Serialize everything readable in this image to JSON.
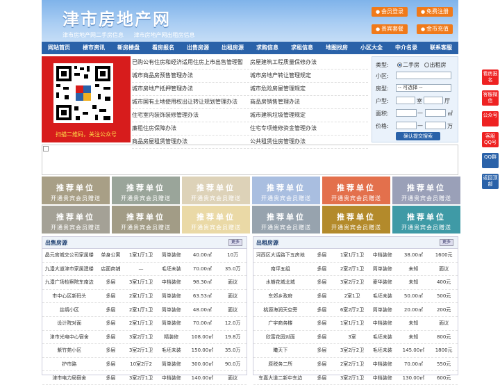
{
  "header": {
    "title": "津市房地产网",
    "tagline": [
      "津市房地产网二手房信息",
      "津市房地产网出租房信息"
    ],
    "buttons": [
      {
        "label": "会员登录",
        "icon": "user-icon"
      },
      {
        "label": "免费注册",
        "icon": "register-icon"
      },
      {
        "label": "贵宾套餐",
        "icon": "vip-icon"
      },
      {
        "label": "金币充值",
        "icon": "coin-icon"
      }
    ]
  },
  "nav": [
    "网站首页",
    "楼市资讯",
    "新房楼盘",
    "看房报名",
    "出售房源",
    "出租房源",
    "求购信息",
    "求租信息",
    "地图找房",
    "小区大全",
    "中介名录",
    "联系客服"
  ],
  "qr": {
    "caption": "扫描二维码，关注公众号"
  },
  "links": [
    [
      "已购公有住房和经济适用住房上市出售管理暂",
      "房屋建筑工程质量保修办法"
    ],
    [
      "城市商品房预售管理办法",
      "城市房地产转让管理规定"
    ],
    [
      "城市房地产抵押管理办法",
      "城市危险房屋管理规定"
    ],
    [
      "城市国有土地使用权出让转让规划管理办法",
      "商品房销售管理办法"
    ],
    [
      "住宅室内装饰装修管理办法",
      "城市建筑垃圾管理规定"
    ],
    [
      "廉租住房保障办法",
      "住宅专项维修资金管理办法"
    ],
    [
      "商品房屋租赁管理办法",
      "公共租赁住房管理办法"
    ]
  ],
  "search": {
    "type_label": "类型:",
    "type_options": [
      "二手房",
      "出租房"
    ],
    "district_label": "小区:",
    "house_label": "房型:",
    "house_value": "-- 可选择 --",
    "layout_label": "户型:",
    "room_unit": "室",
    "hall_unit": "厅",
    "area_label": "面积:",
    "area_unit": "㎡",
    "price_label": "价格:",
    "price_unit": "万",
    "range_sep": "—",
    "submit": "确认提交搜索"
  },
  "tiles": {
    "line1": "推荐单位",
    "line2": "开通贵宾会员赠送",
    "colors": [
      "#a89f86",
      "#9aa59a",
      "#ddd2b8",
      "#a9bee0",
      "#e3704c",
      "#9aa0b8",
      "#a4a196",
      "#a29c86",
      "#ead9a6",
      "#97a3ae",
      "#b38a2b",
      "#3f9aa6"
    ]
  },
  "sale": {
    "title": "出售房源",
    "more": "更多",
    "rows": [
      [
        "晶元宫城交公司家属楼",
        "单身公寓",
        "1室1厅1卫",
        "简单装修",
        "40.00㎡",
        "10万"
      ],
      [
        "九澧大道津市家属建楼",
        "店面商铺",
        "—",
        "毛坯未装",
        "70.00㎡",
        "35.0万"
      ],
      [
        "九澧广场检察院东南边",
        "多层",
        "3室1厅1卫",
        "中档装修",
        "98.30㎡",
        "面议"
      ],
      [
        "市中心区新码头",
        "多层",
        "2室1厅1卫",
        "简单装修",
        "63.53㎡",
        "面议"
      ],
      [
        "丝绸小区",
        "多层",
        "2室1厅1卫",
        "简单装修",
        "48.00㎡",
        "面议"
      ],
      [
        "设计院对面",
        "多层",
        "2室1厅1卫",
        "简单装修",
        "70.00㎡",
        "12.0万"
      ],
      [
        "津市光电中心宿舍",
        "多层",
        "3室2厅1卫",
        "精装修",
        "108.00㎡",
        "19.8万"
      ],
      [
        "紫竹苑小区",
        "多层",
        "3室2厅1卫",
        "毛坯未装",
        "150.00㎡",
        "35.0万"
      ],
      [
        "护市路",
        "多层",
        "10室2厅2",
        "简单装修",
        "300.00㎡",
        "90.0万"
      ],
      [
        "津市电力局宿舍",
        "多层",
        "3室2厅1卫",
        "中档装修",
        "140.00㎡",
        "面议"
      ]
    ]
  },
  "rent": {
    "title": "出租房源",
    "more": "更多",
    "rows": [
      [
        "河西区大话路下五房地",
        "多层",
        "1室1厅1卫",
        "中档装修",
        "38.00㎡",
        "1600元"
      ],
      [
        "南坪五组",
        "多层",
        "2室2厅1卫",
        "简单装修",
        "未知",
        "面议"
      ],
      [
        "水樹花城北城",
        "多层",
        "3室2厅2卫",
        "豪华装修",
        "未知",
        "400元"
      ],
      [
        "东郊乡政府",
        "多层",
        "2室1卫",
        "毛坯未装",
        "50.00㎡",
        "500元"
      ],
      [
        "桃源海润天空旁",
        "多层",
        "6室2厅2卫",
        "简单装修",
        "20.00㎡",
        "200元"
      ],
      [
        "广宇商务楼",
        "多层",
        "1室1厅1卫",
        "中档装修",
        "未知",
        "面议"
      ],
      [
        "欣富花园对面",
        "多层",
        "3室",
        "毛坯未装",
        "未知",
        "800元"
      ],
      [
        "曦天下",
        "多层",
        "3室2厅2卫",
        "毛坯未装",
        "145.00㎡",
        "1800元"
      ],
      [
        "原税务二所",
        "多层",
        "2室2厅1卫",
        "中档装修",
        "70.00㎡",
        "550元"
      ],
      [
        "车嘉大道二新中东边",
        "多层",
        "3室2厅1卫",
        "中档装修",
        "130.00㎡",
        "600元"
      ]
    ]
  },
  "float": [
    {
      "label": "看房报名"
    },
    {
      "label": "客服微信"
    },
    {
      "label": "公众号"
    },
    {
      "label": "客服QQ号"
    },
    {
      "label": "QQ群"
    },
    {
      "label": "返回顶部"
    }
  ],
  "colors": {
    "nav": "#2a62a9",
    "accent": "#f07a1a",
    "qr_bg": "#d71c1c",
    "float": "#e22222"
  }
}
